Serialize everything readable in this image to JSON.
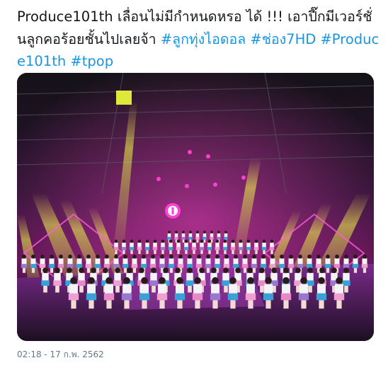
{
  "tweet": {
    "text": "Produce101th เลื่อนไม่มีกำหนดหรอ ได้ !!! เอาปี๊กมีเวอร์ชั่นลูกคอร้อยชั้นไปเลยจ้า ",
    "hashtags": [
      "#ลูกทุ่งไอดอล",
      "#ช่อง7HD",
      "#Produce101th",
      "#tpop"
    ],
    "timestamp": "02:18 - 17 ก.พ. 2562"
  },
  "media": {
    "description_icon": "stage-photo",
    "accent_colors": [
      "#e23dd0",
      "#ffe733",
      "#7a2fb8",
      "#1a1a22"
    ]
  }
}
